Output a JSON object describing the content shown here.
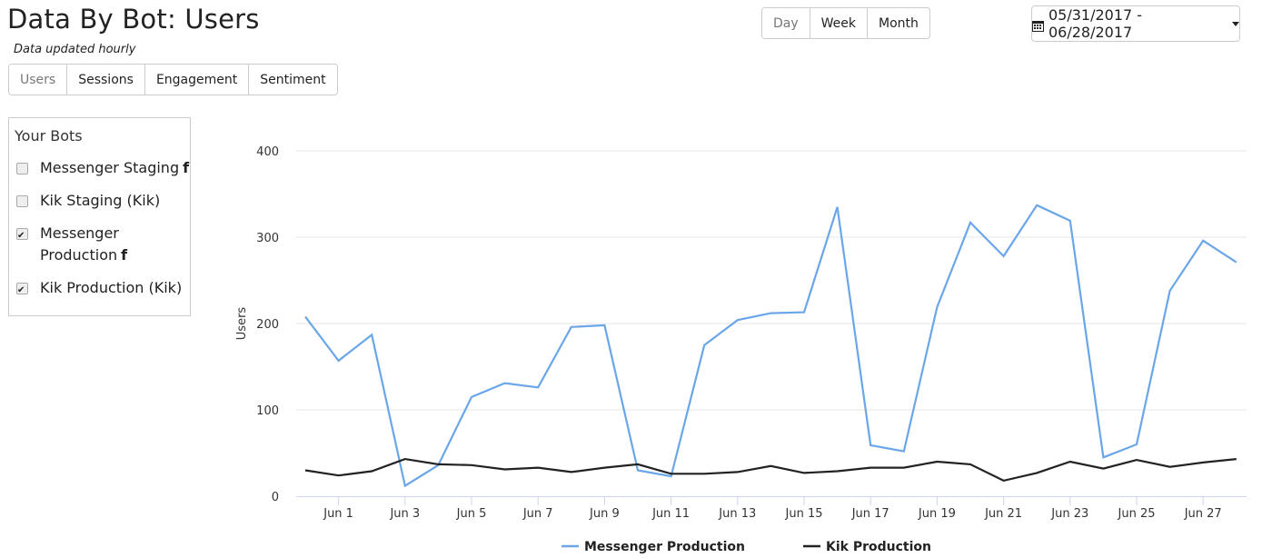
{
  "header": {
    "title": "Data By Bot: Users",
    "subtitle": "Data updated hourly"
  },
  "tabs": [
    {
      "label": "Users",
      "active": true
    },
    {
      "label": "Sessions",
      "active": false
    },
    {
      "label": "Engagement",
      "active": false
    },
    {
      "label": "Sentiment",
      "active": false
    }
  ],
  "range_buttons": [
    {
      "label": "Day",
      "active": true
    },
    {
      "label": "Week",
      "active": false
    },
    {
      "label": "Month",
      "active": false
    }
  ],
  "date_range": {
    "label": "05/31/2017 - 06/28/2017",
    "icon": "calendar-icon"
  },
  "bots_panel": {
    "title": "Your Bots",
    "items": [
      {
        "label": "Messenger Staging",
        "checked": false,
        "platform_icon": "facebook-icon"
      },
      {
        "label": "Kik Staging (Kik)",
        "checked": false,
        "platform_icon": ""
      },
      {
        "label": "Messenger Production",
        "checked": true,
        "platform_icon": "facebook-icon"
      },
      {
        "label": "Kik Production (Kik)",
        "checked": true,
        "platform_icon": ""
      }
    ]
  },
  "colors": {
    "messenger": "#6aa6e8",
    "kik": "#222222",
    "grid": "#e6e6e6",
    "axis": "#ccd6eb"
  },
  "chart_data": {
    "type": "line",
    "title": "",
    "xlabel": "",
    "ylabel": "Users",
    "ylim": [
      0,
      400
    ],
    "yticks": [
      0,
      100,
      200,
      300,
      400
    ],
    "grid": true,
    "legend_position": "bottom-center",
    "x": [
      "May 31",
      "Jun 1",
      "Jun 2",
      "Jun 3",
      "Jun 4",
      "Jun 5",
      "Jun 6",
      "Jun 7",
      "Jun 8",
      "Jun 9",
      "Jun 10",
      "Jun 11",
      "Jun 12",
      "Jun 13",
      "Jun 14",
      "Jun 15",
      "Jun 16",
      "Jun 17",
      "Jun 18",
      "Jun 19",
      "Jun 20",
      "Jun 21",
      "Jun 22",
      "Jun 23",
      "Jun 24",
      "Jun 25",
      "Jun 26",
      "Jun 27",
      "Jun 28"
    ],
    "xtick_labels": [
      "Jun 1",
      "Jun 3",
      "Jun 5",
      "Jun 7",
      "Jun 9",
      "Jun 11",
      "Jun 13",
      "Jun 15",
      "Jun 17",
      "Jun 19",
      "Jun 21",
      "Jun 23",
      "Jun 25",
      "Jun 27"
    ],
    "xtick_indices": [
      1,
      3,
      5,
      7,
      9,
      11,
      13,
      15,
      17,
      19,
      21,
      23,
      25,
      27
    ],
    "series": [
      {
        "name": "Messenger Production",
        "color": "#6aa6e8",
        "values": [
          208,
          157,
          187,
          12,
          36,
          115,
          131,
          126,
          196,
          198,
          30,
          23,
          175,
          204,
          212,
          213,
          335,
          59,
          52,
          219,
          317,
          278,
          337,
          319,
          45,
          60,
          238,
          296,
          271
        ]
      },
      {
        "name": "Kik Production",
        "color": "#222222",
        "values": [
          30,
          24,
          29,
          43,
          37,
          36,
          31,
          33,
          28,
          33,
          37,
          26,
          26,
          28,
          35,
          27,
          29,
          33,
          33,
          40,
          37,
          18,
          27,
          40,
          32,
          42,
          34,
          39,
          43
        ]
      }
    ]
  }
}
